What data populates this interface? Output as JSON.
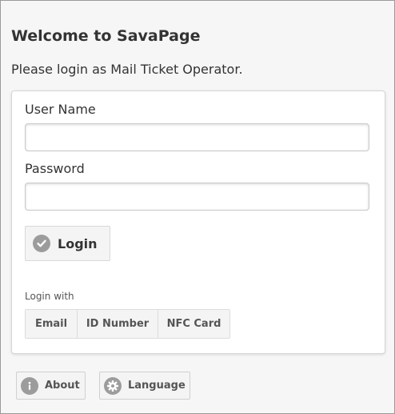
{
  "header": {
    "title": "Welcome to SavaPage",
    "subtitle": "Please login as Mail Ticket Operator."
  },
  "form": {
    "username_label": "User Name",
    "username_value": "",
    "password_label": "Password",
    "password_value": "",
    "login_label": "Login",
    "login_icon": "check-icon",
    "login_with_label": "Login with",
    "methods": [
      "Email",
      "ID Number",
      "NFC Card"
    ]
  },
  "footer": {
    "about_label": "About",
    "about_icon": "info-icon",
    "language_label": "Language",
    "language_icon": "gear-icon"
  },
  "colors": {
    "background": "#f6f6f6",
    "card": "#ffffff",
    "icon_gray": "#9c9c9c",
    "text": "#333333"
  }
}
